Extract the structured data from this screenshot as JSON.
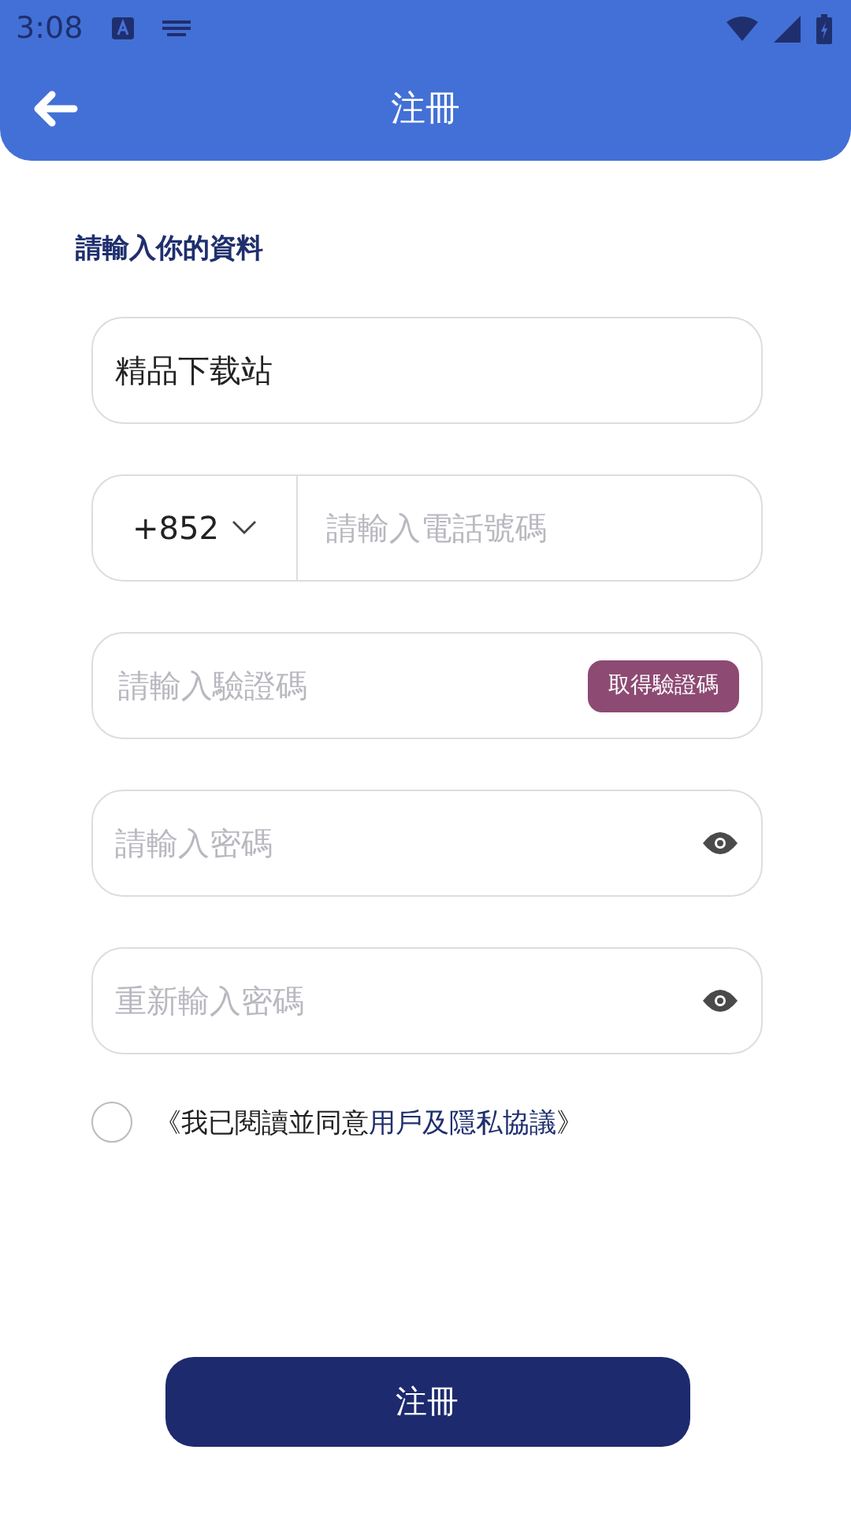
{
  "status_bar": {
    "time": "3:08"
  },
  "header": {
    "title": "注冊"
  },
  "section_title": "請輸入你的資料",
  "fields": [
    {
      "kind": "text",
      "value": "精品下载站"
    },
    {
      "kind": "phone",
      "country_code": "+852",
      "placeholder": "請輸入電話號碼"
    },
    {
      "kind": "code",
      "placeholder": "請輸入驗證碼",
      "button": "取得驗證碼"
    },
    {
      "kind": "password",
      "placeholder": "請輸入密碼"
    },
    {
      "kind": "password",
      "placeholder": "重新輸入密碼"
    }
  ],
  "agreement": {
    "checked": false,
    "prefix": "《我已閱讀並同意",
    "link": "用戶及隱私協議",
    "suffix": "》"
  },
  "submit": "注冊"
}
